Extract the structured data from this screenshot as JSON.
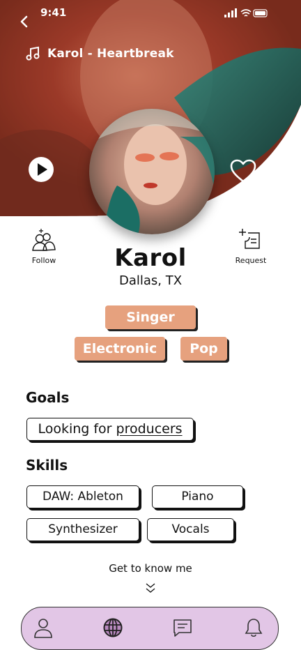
{
  "status": {
    "time": "9:41"
  },
  "hero": {
    "track_title": "Karol - Heartbreak"
  },
  "actions": {
    "follow": "Follow",
    "request": "Request"
  },
  "profile": {
    "name": "Karol",
    "location": "Dallas, TX",
    "tags": [
      "Singer",
      "Electronic",
      "Pop"
    ]
  },
  "goals": {
    "heading": "Goals",
    "text_prefix": "Looking for ",
    "text_link": "producers"
  },
  "skills": {
    "heading": "Skills",
    "items": [
      "DAW: Ableton",
      "Piano",
      "Synthesizer",
      "Vocals"
    ]
  },
  "more": {
    "label": "Get to know me"
  },
  "colors": {
    "tag_bg": "#e6a17e",
    "navbar_bg": "#e2c6e6",
    "hero_red": "#b33a25",
    "hero_teal": "#1f6b63"
  },
  "nav": [
    "profile-icon",
    "globe-icon",
    "chat-icon",
    "bell-icon"
  ]
}
